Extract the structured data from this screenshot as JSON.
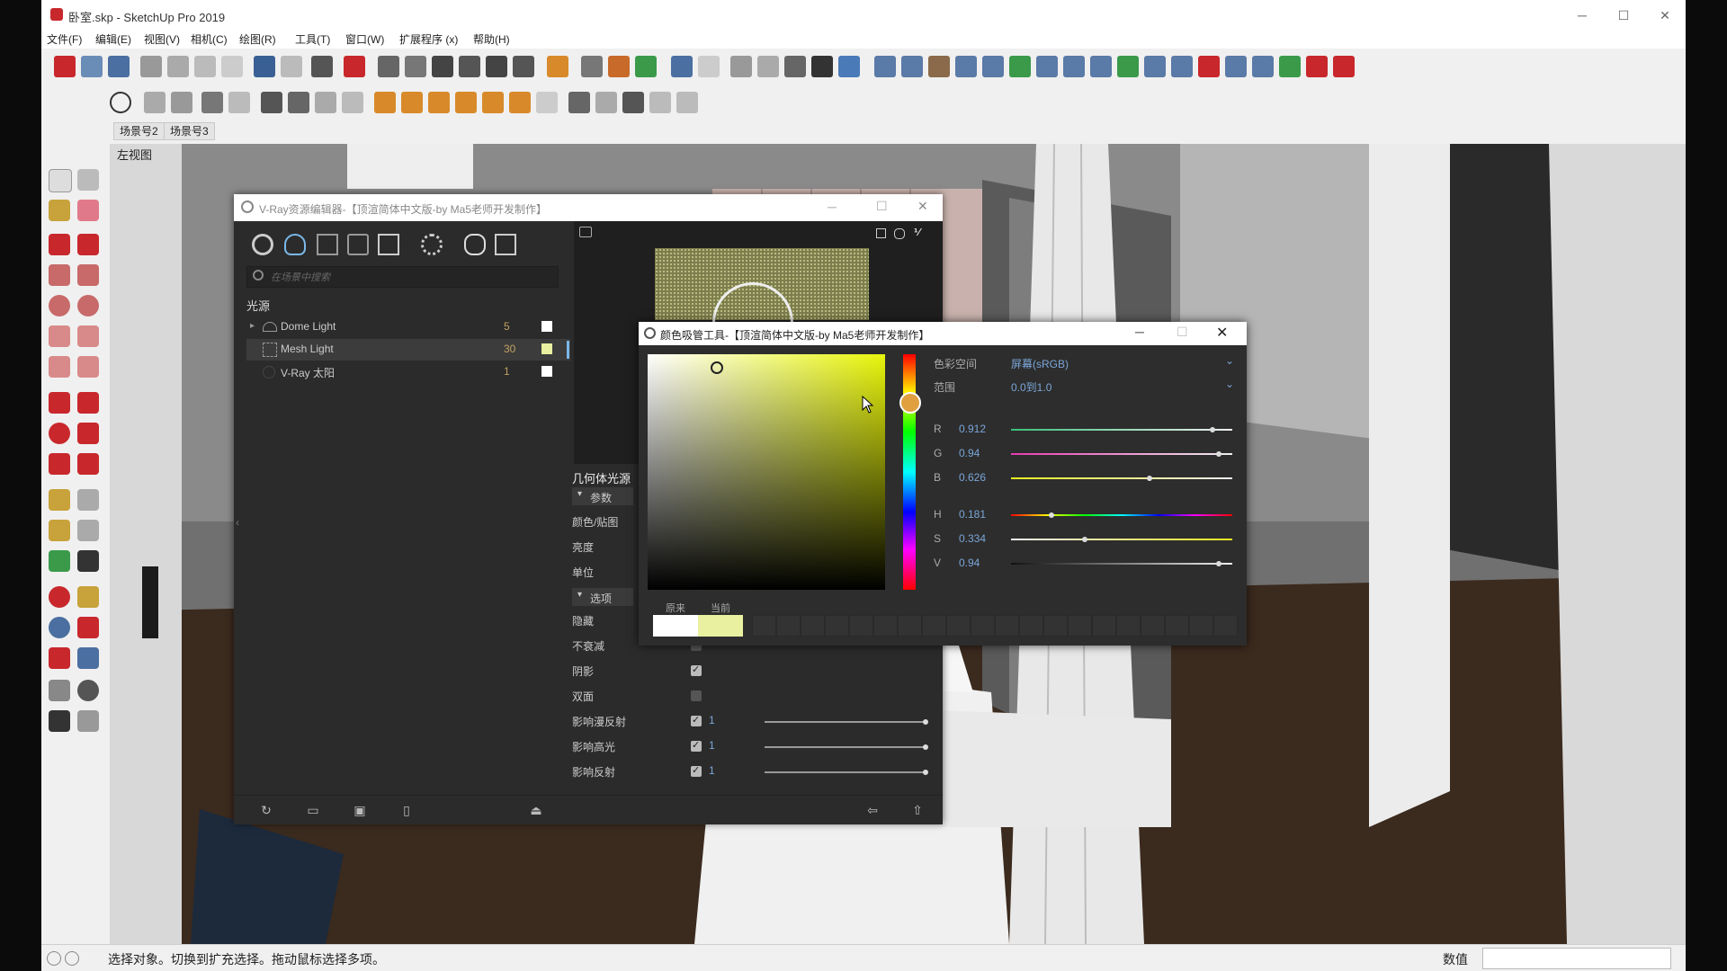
{
  "window": {
    "title": "卧室.skp - SketchUp Pro 2019",
    "controls": {
      "minimize": "─",
      "maximize": "☐",
      "close": "✕"
    }
  },
  "menu": [
    "文件(F)",
    "编辑(E)",
    "视图(V)",
    "相机(C)",
    "绘图(R)",
    "工具(T)",
    "窗口(W)",
    "扩展程序 (x)",
    "帮助(H)"
  ],
  "scene_tabs": [
    "场景号2",
    "场景号3"
  ],
  "viewport": {
    "view_label": "左视图"
  },
  "status_bar": {
    "message": "选择对象。切换到扩充选择。拖动鼠标选择多项。",
    "measurements_label": "数值"
  },
  "vray_editor": {
    "title": "V-Ray资源编辑器-【顶渲简体中文版-by Ma5老师开发制作】",
    "search_placeholder": "在场景中搜索",
    "section_label": "光源",
    "lights": [
      {
        "name": "Dome Light",
        "count": "5",
        "swatch": "#ffffff"
      },
      {
        "name": "Mesh Light",
        "count": "30",
        "swatch": "#e9f0a0"
      },
      {
        "name": "V-Ray 太阳",
        "count": "1",
        "swatch": "#ffffff"
      }
    ],
    "params": {
      "header": "几何体光源",
      "group_params": "参数",
      "color_texture": "颜色/贴图",
      "brightness": "亮度",
      "unit": "单位",
      "group_options": "选项",
      "options": [
        {
          "label": "隐藏",
          "checked": false
        },
        {
          "label": "不衰减",
          "checked": false
        },
        {
          "label": "阴影",
          "checked": true
        },
        {
          "label": "双面",
          "checked": false
        },
        {
          "label": "影响漫反射",
          "checked": true,
          "value": "1"
        },
        {
          "label": "影响高光",
          "checked": true,
          "value": "1"
        },
        {
          "label": "影响反射",
          "checked": true,
          "value": "1"
        }
      ]
    }
  },
  "color_picker": {
    "title": "颜色吸管工具-【顶渲简体中文版-by Ma5老师开发制作】",
    "color_space_label": "色彩空间",
    "color_space_value": "屏幕(sRGB)",
    "range_label": "范围",
    "range_value": "0.0到1.0",
    "channels": [
      {
        "label": "R",
        "value": "0.912",
        "fraction": 0.912
      },
      {
        "label": "G",
        "value": "0.94",
        "fraction": 0.94
      },
      {
        "label": "B",
        "value": "0.626",
        "fraction": 0.626
      },
      {
        "label": "H",
        "value": "0.181",
        "fraction": 0.181
      },
      {
        "label": "S",
        "value": "0.334",
        "fraction": 0.334
      },
      {
        "label": "V",
        "value": "0.94",
        "fraction": 0.94
      }
    ],
    "original_label": "原来",
    "current_label": "当前",
    "original_color": "#ffffff",
    "current_color": "#e9f0a0"
  }
}
